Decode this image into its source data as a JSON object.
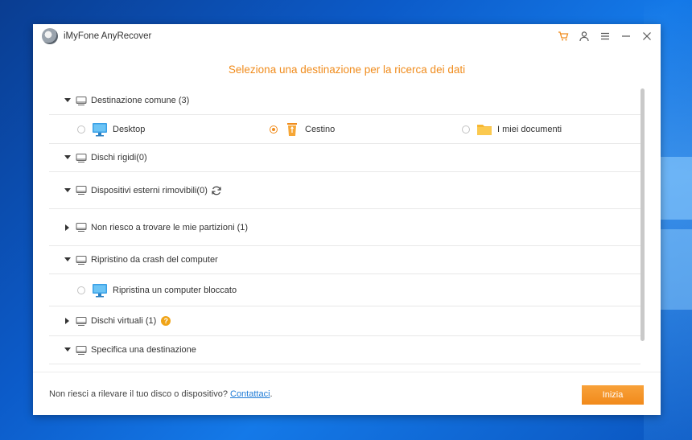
{
  "window": {
    "title": "iMyFone AnyRecover",
    "actions": [
      "cart-icon",
      "user-icon",
      "menu-icon",
      "minimize-icon",
      "close-icon"
    ]
  },
  "heading": "Seleziona una destinazione per la ricerca dei dati",
  "sections": {
    "common": {
      "label": "Destinazione comune (3)",
      "options": [
        {
          "label": "Desktop",
          "icon": "monitor-icon",
          "selected": false
        },
        {
          "label": "Cestino",
          "icon": "trash-icon",
          "selected": true
        },
        {
          "label": "I miei documenti",
          "icon": "folder-icon",
          "selected": false
        }
      ]
    },
    "hard_disks": {
      "label": "Dischi rigidi(0)"
    },
    "external": {
      "label": "Dispositivi esterni rimovibili(0)"
    },
    "partitions": {
      "label": "Non riesco a trovare le mie partizioni (1)"
    },
    "crash": {
      "label": "Ripristino da crash del computer",
      "option": {
        "label": "Ripristina un computer bloccato",
        "icon": "monitor-icon",
        "selected": false
      }
    },
    "virtual": {
      "label": "Dischi virtuali (1)",
      "help": "?"
    },
    "specify": {
      "label": "Specifica una destinazione"
    }
  },
  "footer": {
    "text": "Non riesci a rilevare il tuo disco o dispositivo?",
    "link": "Contattaci",
    "link_suffix": ".",
    "start_label": "Inizia"
  },
  "colors": {
    "accent": "#f08c1d",
    "link": "#1e7bd6",
    "desktop_bg": "#0c5bc9"
  }
}
